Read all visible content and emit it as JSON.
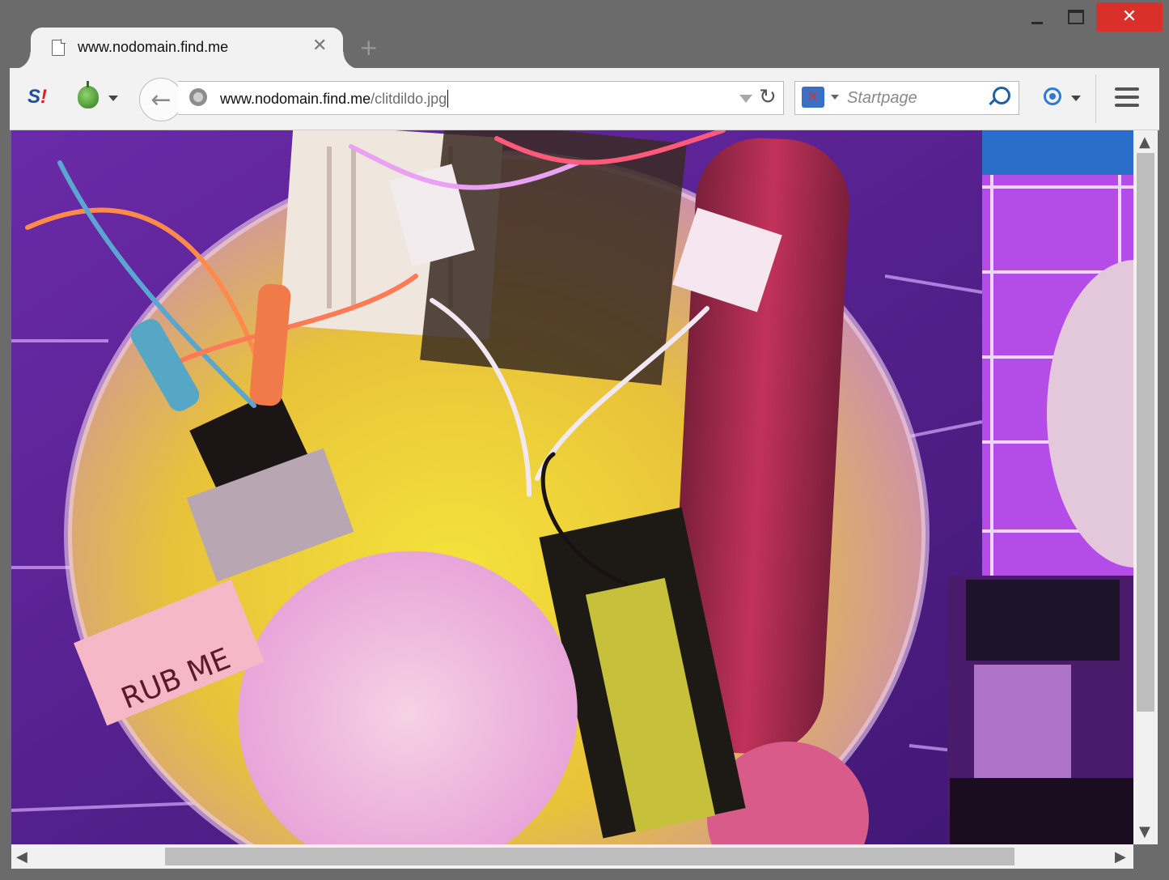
{
  "window": {
    "minimize_icon": "minimize-icon",
    "maximize_icon": "maximize-icon",
    "close_icon": "close-icon",
    "close_glyph": "✕"
  },
  "tab": {
    "title": "www.nodomain.find.me",
    "close_glyph": "✕",
    "new_tab_glyph": "+"
  },
  "toolbar": {
    "url_host": "www.nodomain.find.me",
    "url_path": "/clitdildo.jpg",
    "search_placeholder": "Startpage",
    "back_glyph": "←",
    "reload_glyph": "↻"
  },
  "page": {
    "image_label": "RUB ME"
  },
  "scrollbars": {
    "up": "▲",
    "down": "▼",
    "left": "◀",
    "right": "▶"
  },
  "colors": {
    "close_button": "#d9302a",
    "link_blue": "#1f5fa8",
    "frame": "#6b6b6b"
  }
}
